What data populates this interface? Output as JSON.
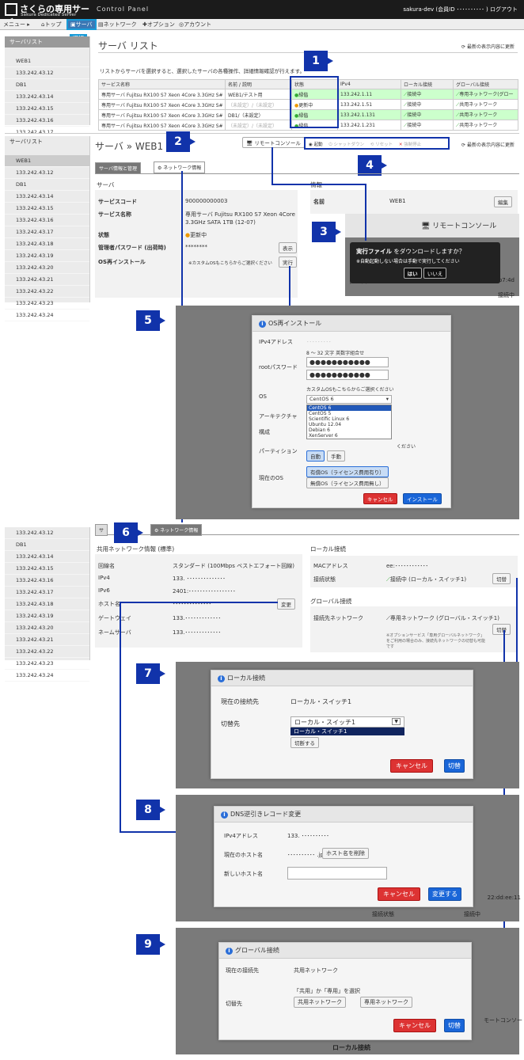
{
  "header": {
    "logo": "さくらの専用サーバ",
    "logo_sub": "Sakura Dedicated Server",
    "product": "Control Panel",
    "user": "sakura-dev (会員ID ･･････････ ) ログアウト"
  },
  "menu": {
    "items": [
      "メニュー ▸",
      "トップ",
      "サーバ",
      "ネットワーク",
      "オプション",
      "アカウント"
    ],
    "select_label": "選択"
  },
  "sidebar1": {
    "header": "サーバリスト",
    "items": [
      "WEB1",
      "133.242.43.12",
      "DB1",
      "133.242.43.14",
      "133.242.43.15",
      "133.242.43.16",
      "133.242.43.17"
    ]
  },
  "list": {
    "title": "サーバ リスト",
    "refresh": "最新の表示内容に更新",
    "desc": "リストからサーバを選択すると、選択したサーバの各種操作、詳細情報確認が行えます。",
    "columns": [
      "サービス名称",
      "名前 / 説明",
      "状態",
      "IPv4",
      "ローカル接続",
      "グローバル接続"
    ],
    "rows": [
      [
        "専用サーバ Fujitsu RX100 S7 Xeon 4Core 3.3GHz S#",
        "WEB1/テスト用",
        "緑偕",
        "133.242.1.11",
        "接続中",
        "専用ネットワーク(グロー"
      ],
      [
        "専用サーバ Fujitsu RX100 S7 Xeon 4Core 3.3GHz S#",
        "（未設定）/（未設定）",
        "更新中",
        "133.242.1.51",
        "接続中",
        "共用ネットワーク"
      ],
      [
        "専用サーバ Fujitsu RX100 S7 Xeon 4Core 3.3GHz S#",
        "DB1/（未設定）",
        "緑偕",
        "133.242.1.131",
        "接続中",
        "共用ネットワーク"
      ],
      [
        "専用サーバ Fujitsu RX100 S7 Xeon 4Core 3.3GHz S#",
        "（未設定）/（未設定）",
        "緑偕",
        "133.242.1.231",
        "接続中",
        "共用ネットワーク"
      ]
    ]
  },
  "badges": [
    "1",
    "2",
    "3",
    "4",
    "5",
    "6",
    "7",
    "8",
    "9"
  ],
  "sidebar2": {
    "header": "サーバリスト",
    "items": [
      "WEB1",
      "133.242.43.12",
      "DB1",
      "133.242.43.14",
      "133.242.43.15",
      "133.242.43.16",
      "133.242.43.17",
      "133.242.43.18",
      "133.242.43.19",
      "133.242.43.20",
      "133.242.43.21",
      "133.242.43.22",
      "133.242.43.23",
      "133.242.43.24"
    ]
  },
  "detail": {
    "crumb": "サーバ » WEB1",
    "remote": "リモートコンソール",
    "actions": [
      "起動",
      "シャットダウン",
      "リセット",
      "強制停止"
    ],
    "refresh": "最新の表示内容に更新",
    "tabs": [
      "サーバ情報と管理",
      "ネットワーク情報"
    ],
    "section": "サーバ",
    "info_section": "情報",
    "fields": [
      [
        "サービスコード",
        "900000000003"
      ],
      [
        "サービス名称",
        "専用サーバ Fujitsu RX100 S7 Xeon 4Core 3.3GHz SATA 1TB (12-07)"
      ],
      [
        "状態",
        "更新中"
      ],
      [
        "管理者パスワード (出荷時)",
        "********"
      ],
      [
        "OS再インストール",
        "※カスタムOSもこちらからご選択ください"
      ]
    ],
    "show_btn": "表示",
    "exec_btn": "実行",
    "name_label": "名前",
    "name_value": "WEB1",
    "edit_btn": "編集"
  },
  "popup3": {
    "remote": "リモートコンソール",
    "line1a": "実行ファイル",
    "line1b": " をダウンロードしますか？",
    "line2": "※自動起動しない場合は手動で実行してください",
    "yes": "はい",
    "no": "いいえ",
    "bg1": "ドレス",
    "bg2": "22:b7:4d",
    "bg3": "接続中"
  },
  "os_dialog": {
    "title": "OS再インストール",
    "ipv4": "IPv4アドレス",
    "pw_hint": "8 ～ 32 文字 英数字組合せ",
    "root_pw": "rootパスワード",
    "pw_mask": "●●●●●●●●●●●",
    "os": "OS",
    "os_hint": "カスタムOSもこちらからご選択ください",
    "os_selected": "CentOS 6",
    "os_options": [
      "CentOS 6",
      "CentOS 5",
      "Scientific Linux 6",
      "Ubuntu 12.04",
      "Debian 6",
      "XenServer 6"
    ],
    "arch": "アーキテクチャ",
    "config": "構成",
    "partition": "パーティション",
    "part_auto": "自動",
    "part_manual": "手動",
    "part_tail": "ください",
    "current_os": "現在のOS",
    "paid": "有償OS（ライセンス費用有り）",
    "free": "無償OS（ライセンス費用無し）",
    "cancel": "キャンセル",
    "install": "インストール"
  },
  "sidebar3": {
    "items": [
      "133.242.43.12",
      "DB1",
      "133.242.43.14",
      "133.242.43.15",
      "133.242.43.16",
      "133.242.43.17",
      "133.242.43.18",
      "133.242.43.19",
      "133.242.43.20",
      "133.242.43.21",
      "133.242.43.22",
      "133.242.43.23",
      "133.242.43.24"
    ]
  },
  "net": {
    "tab_left": "サ",
    "tab_on": "ネットワーク情報",
    "shared_title": "共用ネットワーク情報 (標準)",
    "local_title": "ローカル接続",
    "global_title": "グローバル接続",
    "rows": [
      [
        "回線名",
        "スタンダード (100Mbps ベストエフォート回線)"
      ],
      [
        "IPv4",
        "133. ･･････････････"
      ],
      [
        "IPv6",
        "2401:･････････････････"
      ],
      [
        "ホスト名",
        "･･････････････"
      ],
      [
        "ゲートウェイ",
        "133.･････････････"
      ],
      [
        "ネームサーバ",
        "133.･････････････"
      ]
    ],
    "change": "変更",
    "mac": "MACアドレス",
    "mac_val": "ee:････････････",
    "local_state": "接続状態",
    "local_val": "接続中 (ローカル・スイッチ1)",
    "switch": "切替",
    "global_net": "接続先ネットワーク",
    "global_val": "専用ネットワーク (グローバル・スイッチ1)",
    "note": "※オプションサービス「専用グローバルネットワーク」をご利用の場合のみ、接続先ネットワークの切替も可能です"
  },
  "local_dialog": {
    "title": "ローカル接続",
    "current_label": "現在の接続先",
    "current": "ローカル・スイッチ1",
    "target_label": "切替先",
    "selected": "ローカル・スイッチ1",
    "option": "ローカル・スイッチ1",
    "disconnect": "切断する",
    "cancel": "キャンセル",
    "ok": "切替"
  },
  "dns_dialog": {
    "title": "DNS逆引きレコード変更",
    "ipv4_label": "IPv4アドレス",
    "ipv4": "133. ･･････････",
    "current_label": "現在のホスト名",
    "current": "･･････････ .jp",
    "delete": "ホスト名を削除",
    "new_label": "新しいホスト名",
    "cancel": "キャンセル",
    "ok": "変更する",
    "bg": "22:dd:ee:11",
    "bg2": "接続状態",
    "bg3": "接続中"
  },
  "global_dialog": {
    "title": "グローバル接続",
    "current_label": "現在の接続先",
    "current": "共用ネットワーク",
    "target_label": "切替先",
    "hint": "「共用」か「専用」を選択",
    "shared": "共用ネットワーク",
    "dedicated": "専用ネットワーク",
    "cancel": "キャンセル",
    "ok": "切替",
    "bg": "ローカル接続",
    "bg2": "モートコンソー"
  }
}
